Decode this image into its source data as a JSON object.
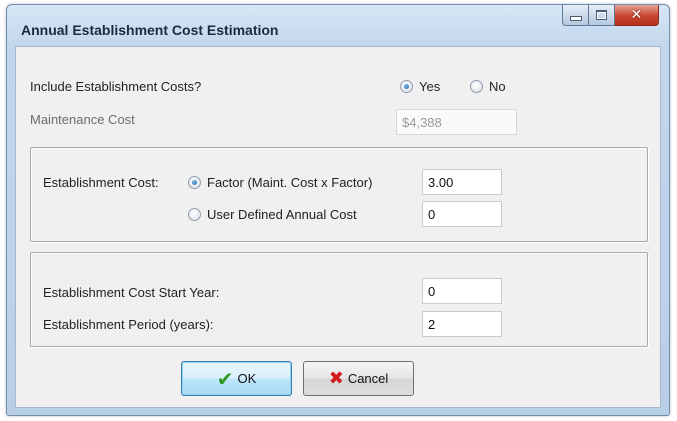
{
  "window": {
    "title": "Annual Establishment Cost Estimation",
    "controls": {
      "minimize": "minimize-icon",
      "maximize": "maximize-icon",
      "close": "close-icon"
    }
  },
  "include": {
    "label": "Include Establishment Costs?",
    "yes_label": "Yes",
    "no_label": "No",
    "selected": "Yes"
  },
  "maintenance": {
    "label": "Maintenance Cost",
    "value": "$4,388"
  },
  "establishment_cost": {
    "label": "Establishment Cost:",
    "factor_label": "Factor (Maint. Cost x Factor)",
    "factor_value": "3.00",
    "user_label": "User Defined Annual Cost",
    "user_value": "0",
    "selected": "factor"
  },
  "period": {
    "start_year_label": "Establishment Cost Start Year:",
    "start_year_value": "0",
    "period_label": "Establishment Period (years):",
    "period_value": "2"
  },
  "buttons": {
    "ok_label": "OK",
    "cancel_label": "Cancel"
  },
  "colors": {
    "accent": "#3c7fb1",
    "ok_icon": "#2e9a24",
    "cancel_icon": "#d21d1d",
    "close_button": "#c7452f"
  }
}
